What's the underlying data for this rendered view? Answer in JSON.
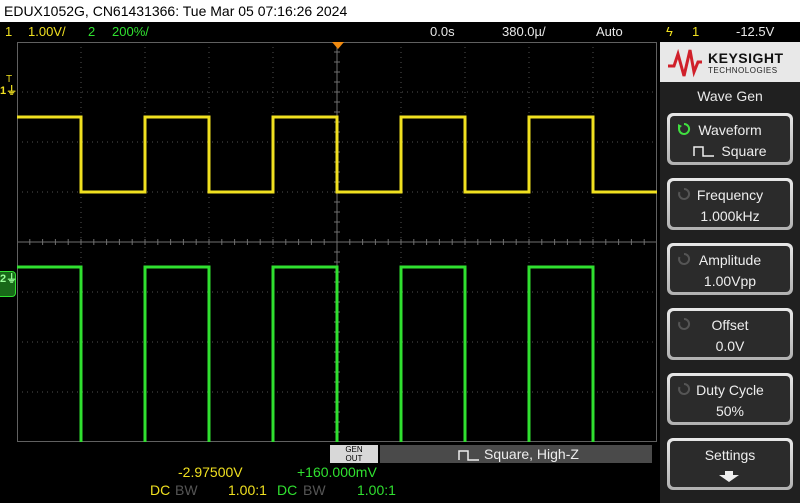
{
  "title": "EDUX1052G, CN61431366: Tue Mar 05 07:16:26 2024",
  "status": {
    "ch1_num": "1",
    "ch1_scale": "1.00V/",
    "ch2_num": "2",
    "ch2_scale": "200&#x2033;/",
    "ch2_scale_text": "200%/",
    "time_offset": "0.0s",
    "time_scale": "380.0µ/",
    "trig_mode": "Auto",
    "trig_symbol": "ϟ",
    "trig_source": "1",
    "trig_level": "-12.5V"
  },
  "markers": {
    "t": "T",
    "ch1": "1",
    "ch2": "2"
  },
  "logo": {
    "name": "KEYSIGHT",
    "sub": "TECHNOLOGIES"
  },
  "menu": {
    "title": "Wave Gen",
    "keys": [
      {
        "label": "Waveform",
        "value": "Square",
        "active": true
      },
      {
        "label": "Frequency",
        "value": "1.000kHz"
      },
      {
        "label": "Amplitude",
        "value": "1.00Vpp"
      },
      {
        "label": "Offset",
        "value": "0.0V"
      },
      {
        "label": "Duty Cycle",
        "value": "50%"
      },
      {
        "label": "Settings",
        "value": ""
      }
    ]
  },
  "bottom": {
    "gen_line1": "GEN",
    "gen_line2": "OUT",
    "gen_status": "Square, High-Z",
    "ch1_offset": "-2.97500V",
    "ch2_offset": "+160.000mV",
    "ch1_coupling": "DC",
    "ch1_bw": "BW",
    "ch1_probe": "1.00:1",
    "ch2_coupling": "DC",
    "ch2_bw": "BW",
    "ch2_probe": "1.00:1"
  },
  "colors": {
    "ch1": "#f0e020",
    "ch2": "#30e030",
    "trigger": "#f08a10",
    "grid": "#505050"
  },
  "waveforms": {
    "period_divisions": 2,
    "duty": 0.5,
    "ch1_levels_div": [
      1.5,
      3.0
    ],
    "ch2_levels_div": [
      4.5,
      9.2
    ]
  }
}
